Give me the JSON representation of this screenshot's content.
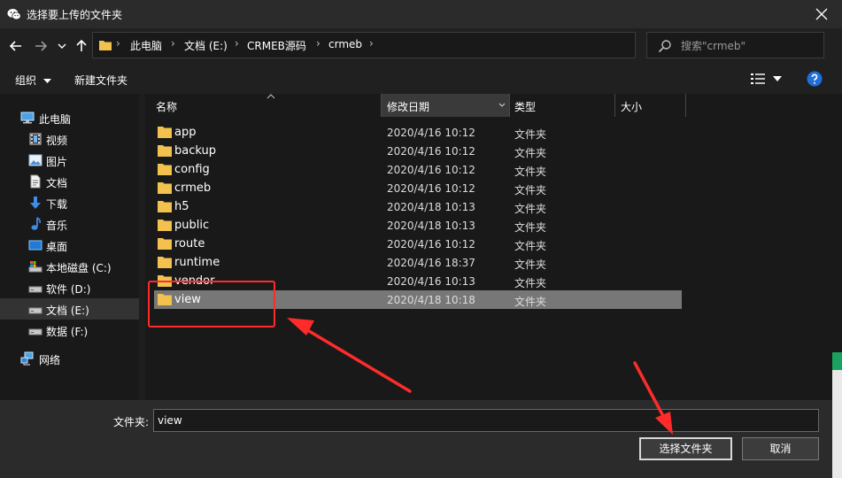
{
  "window": {
    "title": "选择要上传的文件夹",
    "icon": "wechat-icon"
  },
  "nav": {
    "back_icon": "arrow-left-icon",
    "forward_icon": "arrow-right-icon",
    "recent_icon": "chevron-down-icon",
    "up_icon": "arrow-up-icon"
  },
  "address": {
    "crumbs": [
      "此电脑",
      "文档 (E:)",
      "CRMEB源码",
      "crmeb"
    ]
  },
  "search": {
    "placeholder": "搜索\"crmeb\""
  },
  "toolbar": {
    "organize_label": "组织",
    "new_folder_label": "新建文件夹"
  },
  "sidebar": {
    "items": [
      {
        "label": "此电脑",
        "icon": "computer-icon"
      },
      {
        "label": "视频",
        "icon": "video-icon"
      },
      {
        "label": "图片",
        "icon": "picture-icon"
      },
      {
        "label": "文档",
        "icon": "document-icon"
      },
      {
        "label": "下载",
        "icon": "download-icon"
      },
      {
        "label": "音乐",
        "icon": "music-icon"
      },
      {
        "label": "桌面",
        "icon": "desktop-icon"
      },
      {
        "label": "本地磁盘 (C:)",
        "icon": "system-drive-icon"
      },
      {
        "label": "软件 (D:)",
        "icon": "drive-icon"
      },
      {
        "label": "文档 (E:)",
        "icon": "drive-icon",
        "selected": true
      },
      {
        "label": "数据 (F:)",
        "icon": "drive-icon"
      },
      {
        "label": "网络",
        "icon": "network-icon"
      }
    ]
  },
  "columns": {
    "name": "名称",
    "modified": "修改日期",
    "type": "类型",
    "size": "大小"
  },
  "files": [
    {
      "name": "app",
      "modified": "2020/4/16 10:12",
      "type": "文件夹"
    },
    {
      "name": "backup",
      "modified": "2020/4/16 10:12",
      "type": "文件夹"
    },
    {
      "name": "config",
      "modified": "2020/4/16 10:12",
      "type": "文件夹"
    },
    {
      "name": "crmeb",
      "modified": "2020/4/16 10:12",
      "type": "文件夹"
    },
    {
      "name": "h5",
      "modified": "2020/4/18 10:13",
      "type": "文件夹"
    },
    {
      "name": "public",
      "modified": "2020/4/18 10:13",
      "type": "文件夹"
    },
    {
      "name": "route",
      "modified": "2020/4/16 10:12",
      "type": "文件夹"
    },
    {
      "name": "runtime",
      "modified": "2020/4/16 18:37",
      "type": "文件夹"
    },
    {
      "name": "vendor",
      "modified": "2020/4/16 10:13",
      "type": "文件夹"
    },
    {
      "name": "view",
      "modified": "2020/4/18 10:18",
      "type": "文件夹",
      "selected": true
    }
  ],
  "footer": {
    "folder_label": "文件夹:",
    "folder_value": "view",
    "select_button": "选择文件夹",
    "cancel_button": "取消"
  },
  "colors": {
    "annotation": "#ff2b2b",
    "folder": "#f2c14e",
    "selected_row": "#777777"
  }
}
